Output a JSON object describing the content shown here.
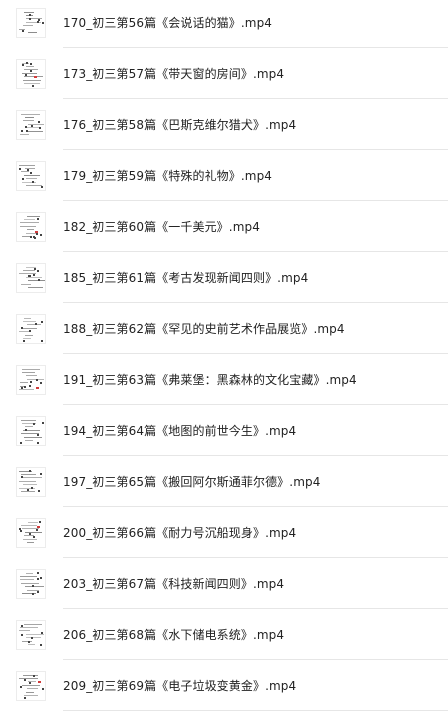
{
  "files": [
    {
      "name": "170_初三第56篇《会说话的猫》.mp4",
      "icon": "video-thumbnail-icon"
    },
    {
      "name": "173_初三第57篇《带天窗的房间》.mp4",
      "icon": "video-thumbnail-icon"
    },
    {
      "name": "176_初三第58篇《巴斯克维尔猎犬》.mp4",
      "icon": "video-thumbnail-icon"
    },
    {
      "name": "179_初三第59篇《特殊的礼物》.mp4",
      "icon": "video-thumbnail-icon"
    },
    {
      "name": "182_初三第60篇《一千美元》.mp4",
      "icon": "video-thumbnail-icon"
    },
    {
      "name": "185_初三第61篇《考古发现新闻四则》.mp4",
      "icon": "video-thumbnail-icon"
    },
    {
      "name": "188_初三第62篇《罕见的史前艺术作品展览》.mp4",
      "icon": "video-thumbnail-icon"
    },
    {
      "name": "191_初三第63篇《弗莱堡：黑森林的文化宝藏》.mp4",
      "icon": "video-thumbnail-icon"
    },
    {
      "name": "194_初三第64篇《地图的前世今生》.mp4",
      "icon": "video-thumbnail-icon"
    },
    {
      "name": "197_初三第65篇《搬回阿尔斯通菲尔德》.mp4",
      "icon": "video-thumbnail-icon"
    },
    {
      "name": "200_初三第66篇《耐力号沉船现身》.mp4",
      "icon": "video-thumbnail-icon"
    },
    {
      "name": "203_初三第67篇《科技新闻四则》.mp4",
      "icon": "video-thumbnail-icon"
    },
    {
      "name": "206_初三第68篇《水下储电系统》.mp4",
      "icon": "video-thumbnail-icon"
    },
    {
      "name": "209_初三第69篇《电子垃圾变黄金》.mp4",
      "icon": "video-thumbnail-icon"
    }
  ],
  "colors": {
    "text": "#222222",
    "divider": "#e6e6e6",
    "background": "#ffffff"
  }
}
